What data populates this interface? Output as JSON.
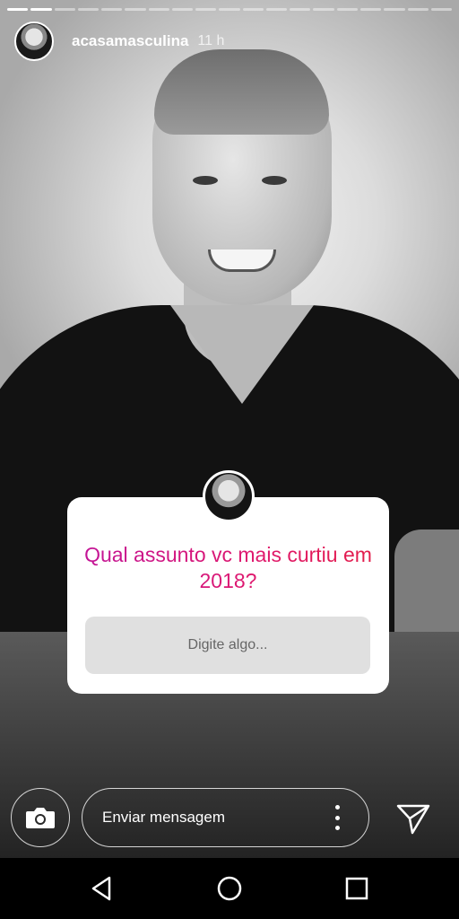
{
  "story": {
    "progress": {
      "total_segments": 19,
      "completed_segments": 2
    },
    "username": "acasamasculina",
    "time": "11 h"
  },
  "question_card": {
    "question": "Qual assunto vc mais curtiu em 2018?",
    "answer_placeholder": "Digite algo...",
    "accent_colors": [
      "#c0139a",
      "#e31e45"
    ]
  },
  "reply_bar": {
    "message_placeholder": "Enviar mensagem",
    "icons": {
      "camera": "camera-icon",
      "more": "more-vertical-icon",
      "send": "send-icon"
    }
  },
  "nav_bar": {
    "icons": [
      "back-triangle-icon",
      "home-circle-icon",
      "recents-square-icon"
    ]
  }
}
